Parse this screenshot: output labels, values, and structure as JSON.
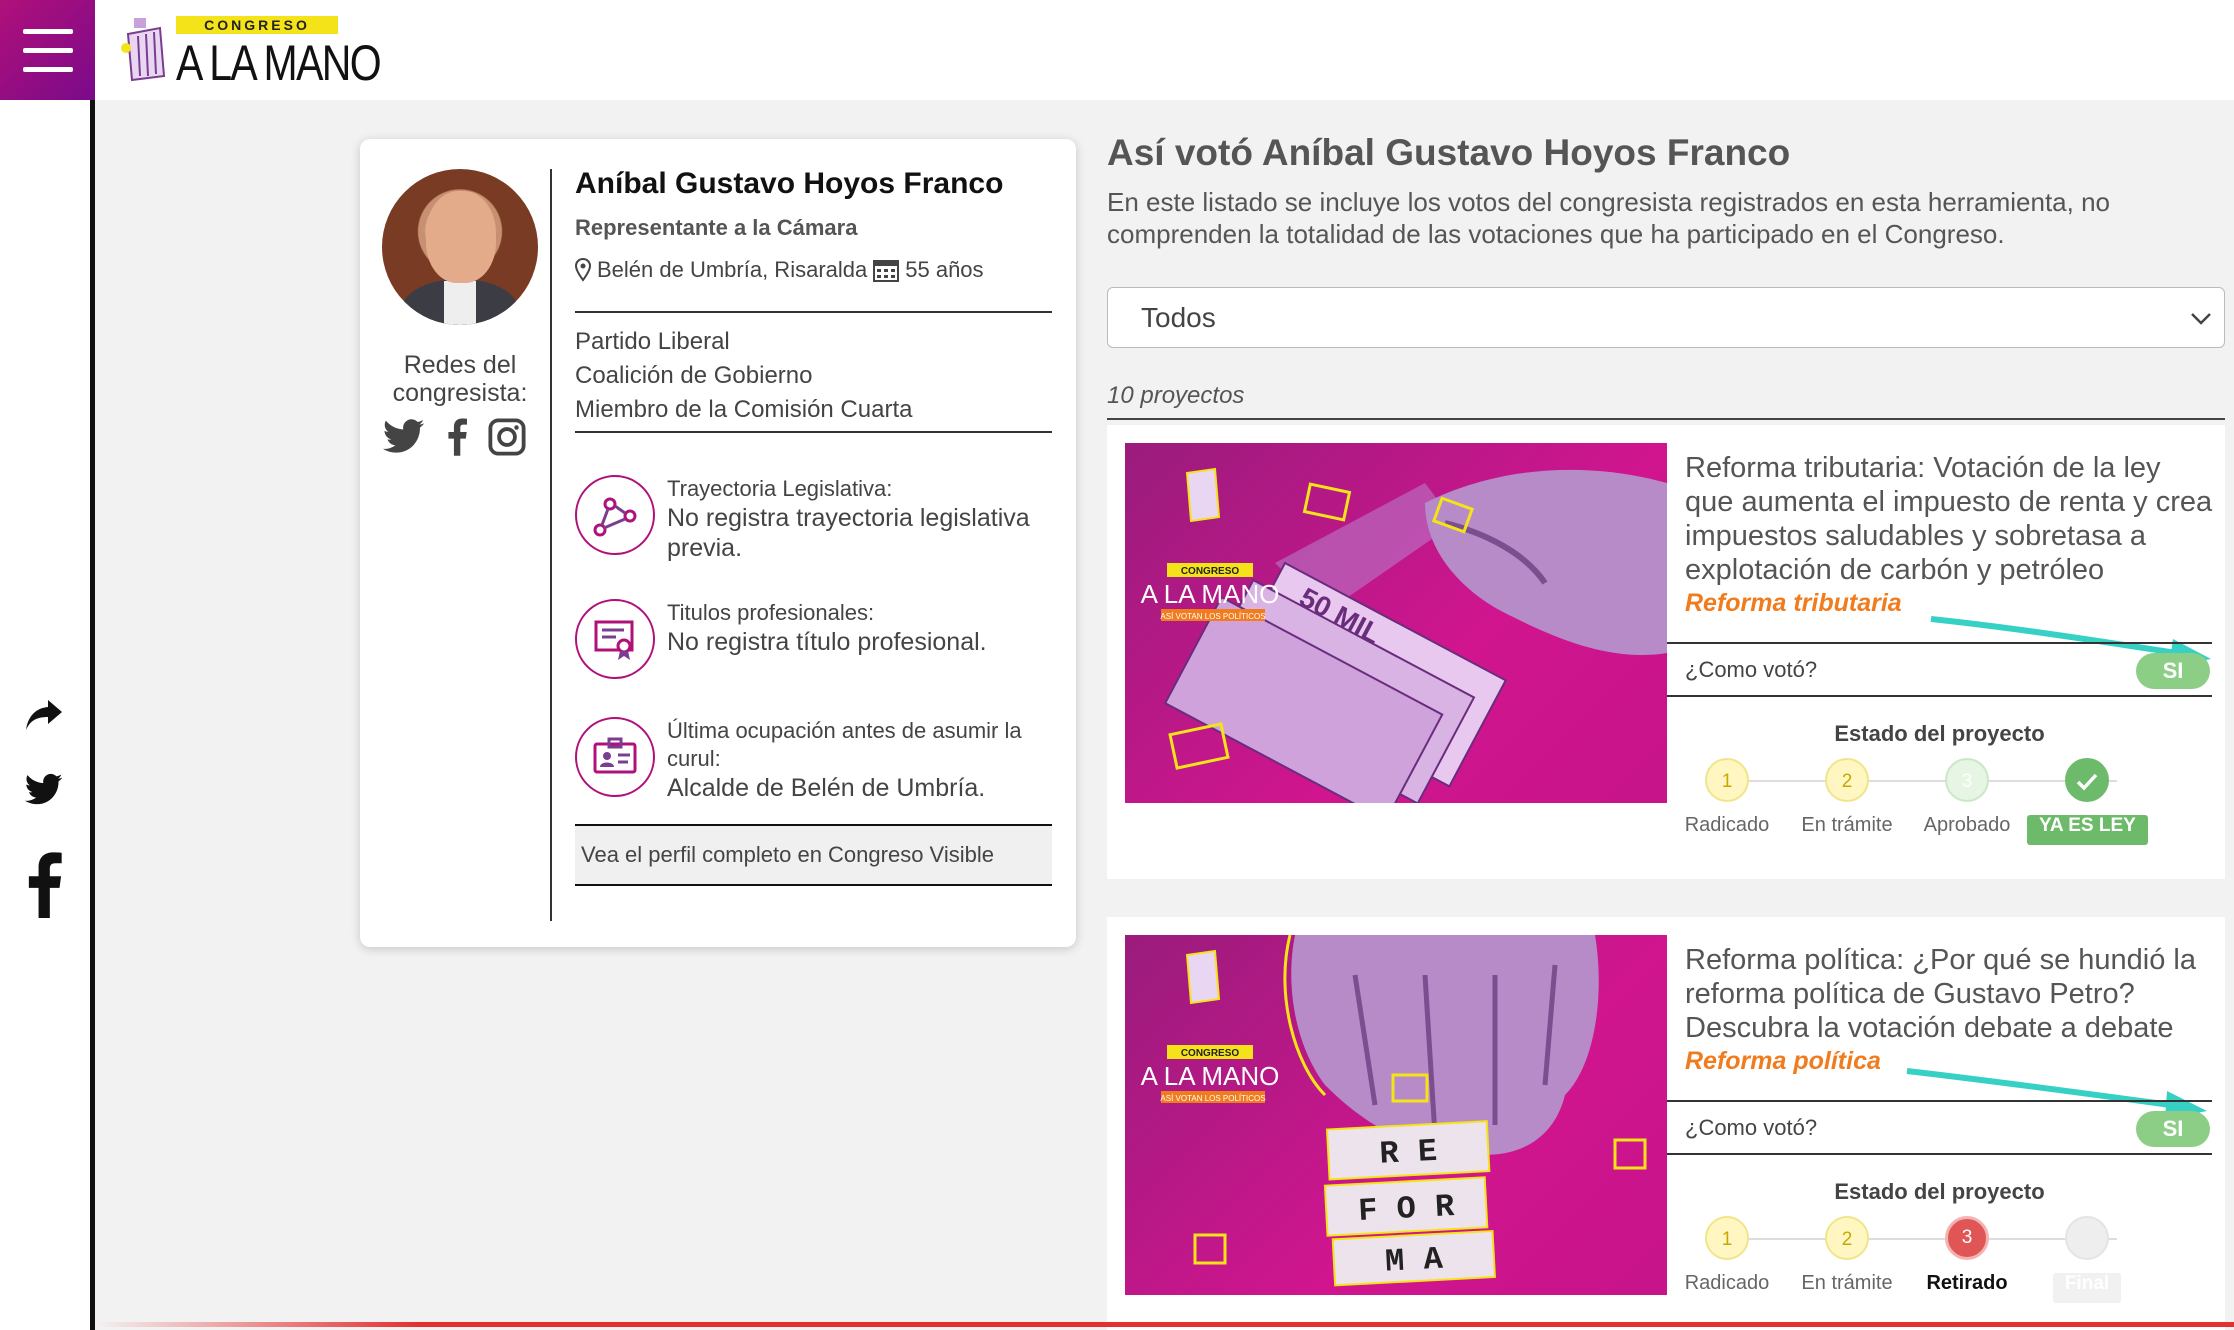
{
  "brand": {
    "badge": "CONGRESO",
    "name": "A LA MANO"
  },
  "profile": {
    "name": "Aníbal Gustavo Hoyos Franco",
    "role": "Representante a la Cámara",
    "location": "Belén de Umbría, Risaralda",
    "age": "55 años",
    "redes_label": "Redes del congresista:",
    "party": "Partido Liberal",
    "coalition": "Coalición de Gobierno",
    "commission": "Miembro de la Comisión Cuarta",
    "trayectoria_title": "Trayectoria Legislativa:",
    "trayectoria_value": "No registra trayectoria legislativa previa.",
    "titulos_title": "Titulos profesionales:",
    "titulos_value": "No registra título profesional.",
    "ocupacion_title": "Última ocupación antes de asumir la curul:",
    "ocupacion_value": "Alcalde de Belén de Umbría.",
    "cv_link": "Vea el perfil completo en Congreso Visible"
  },
  "main": {
    "title": "Así votó Aníbal Gustavo Hoyos Franco",
    "description": "En este listado se incluye los votos del congresista registrados en esta herramienta, no comprenden la totalidad de las votaciones que ha participado en el Congreso.",
    "filter_value": "Todos",
    "count": "10 proyectos"
  },
  "projects": [
    {
      "title": "Reforma tributaria: Votación de la ley que aumenta el impuesto de renta y crea impuestos saludables y sobretasa a explotación de carbón y petróleo",
      "tag": "Reforma tributaria",
      "vote_question": "¿Como votó?",
      "vote": "SI",
      "state_title": "Estado del proyecto",
      "steps": [
        "Radicado",
        "En trámite",
        "Aprobado",
        "YA ES LEY"
      ],
      "step_nums": [
        "1",
        "2",
        "3"
      ],
      "image_logo_badge": "CONGRESO",
      "image_logo_name": "A LA MANO",
      "image_logo_sub": "ASÍ VOTAN LOS POLÍTICOS"
    },
    {
      "title": "Reforma política: ¿Por qué se hundió la reforma política de Gustavo Petro? Descubra la votación debate a debate",
      "tag": "Reforma política",
      "vote_question": "¿Como votó?",
      "vote": "SI",
      "state_title": "Estado del proyecto",
      "steps": [
        "Radicado",
        "En trámite",
        "Retirado",
        "Final"
      ],
      "step_nums": [
        "1",
        "2",
        "3"
      ],
      "image_logo_badge": "CONGRESO",
      "image_logo_name": "A LA MANO",
      "image_logo_sub": "ASÍ VOTAN LOS POLÍTICOS",
      "image_blocks": [
        "R E",
        "F O R",
        "M A"
      ]
    }
  ],
  "colors": {
    "brand": "#b0107a",
    "vote_yes": "#8dce86",
    "tag": "#f07c1e",
    "retirado": "#e05555"
  }
}
